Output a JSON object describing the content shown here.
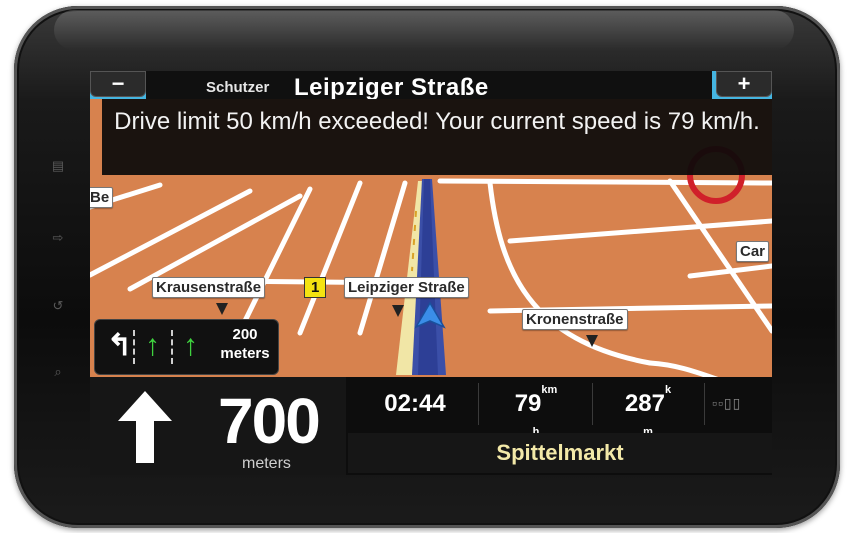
{
  "device": {
    "side_buttons": [
      "menu-icon",
      "back-icon",
      "home-icon",
      "search-icon"
    ]
  },
  "top_bar": {
    "zoom_out_label": "−",
    "zoom_in_label": "+",
    "previous_street": "Schutzer",
    "current_street": "Leipziger Straße",
    "accent_color": "#45b5e1"
  },
  "warning": {
    "message": "Drive limit 50 km/h exceeded! Your current speed is 79 km/h."
  },
  "map": {
    "labels": {
      "krausenstrasse": "Krausenstraße",
      "route_number": "1",
      "leipziger": "Leipziger Straße",
      "kronenstrasse": "Kronenstraße",
      "left_edge": "Be",
      "right_edge": "Car"
    },
    "route_color": "#3b4fa8",
    "background_color": "#d7824e"
  },
  "lanes": {
    "icons": [
      "turn-left-icon",
      "straight-arrow-icon",
      "straight-arrow-icon"
    ],
    "distance_value": "200",
    "distance_unit": "meters"
  },
  "navigation": {
    "next_turn_icon": "straight-arrow-icon",
    "next_turn_distance": "700",
    "next_turn_unit": "meters",
    "time": "02:44",
    "speed_value": "79",
    "speed_unit_top": "km",
    "speed_unit_bottom": "h",
    "distance_remaining": "287",
    "distance_unit_top": "k",
    "distance_unit_bottom": "m",
    "signal_icon": "signal-strength-icon",
    "destination": "Spittelmarkt"
  }
}
